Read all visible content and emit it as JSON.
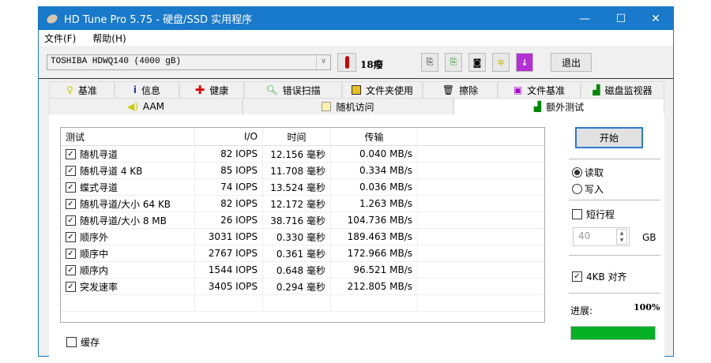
{
  "window": {
    "title": "HD Tune Pro 5.75 - 硬盘/SSD 实用程序",
    "minimize": "—",
    "maximize": "☐",
    "close": "✕"
  },
  "menu": [
    "文件(F)",
    "帮助(H)"
  ],
  "toolbar": {
    "drive": "TOSHIBA HDWQ140 (4000 gB)",
    "temperature": "18癈",
    "exit": "退出"
  },
  "tabs_row1": [
    {
      "label": "基准",
      "icon": "bulb-icon"
    },
    {
      "label": "信息",
      "icon": "info-icon"
    },
    {
      "label": "健康",
      "icon": "health-cross-icon"
    },
    {
      "label": "错误扫描",
      "icon": "magnifier-icon"
    },
    {
      "label": "文件夹使用",
      "icon": "folder-icon"
    },
    {
      "label": "擦除",
      "icon": "trash-icon"
    },
    {
      "label": "文件基准",
      "icon": "file-benchmark-icon"
    },
    {
      "label": "磁盘监视器",
      "icon": "chart-icon"
    }
  ],
  "tabs_row2": [
    {
      "label": "AAM",
      "icon": "speaker-icon"
    },
    {
      "label": "随机访问",
      "icon": "scatter-icon"
    },
    {
      "label": "额外测试",
      "icon": "extra-test-icon"
    }
  ],
  "table": {
    "headers": [
      "测试",
      "I/O",
      "时间",
      "传输"
    ],
    "rows": [
      {
        "test": "随机寻道",
        "io": "82 IOPS",
        "time": "12.156 毫秒",
        "transfer": "0.040 MB/s",
        "checked": true
      },
      {
        "test": "随机寻道 4 KB",
        "io": "85 IOPS",
        "time": "11.708 毫秒",
        "transfer": "0.334 MB/s",
        "checked": true
      },
      {
        "test": "蝶式寻道",
        "io": "74 IOPS",
        "time": "13.524 毫秒",
        "transfer": "0.036 MB/s",
        "checked": true
      },
      {
        "test": "随机寻道/大小 64 KB",
        "io": "82 IOPS",
        "time": "12.172 毫秒",
        "transfer": "1.263 MB/s",
        "checked": true
      },
      {
        "test": "随机寻道/大小 8 MB",
        "io": "26 IOPS",
        "time": "38.716 毫秒",
        "transfer": "104.736 MB/s",
        "checked": true
      },
      {
        "test": "顺序外",
        "io": "3031 IOPS",
        "time": "0.330 毫秒",
        "transfer": "189.463 MB/s",
        "checked": true
      },
      {
        "test": "顺序中",
        "io": "2767 IOPS",
        "time": "0.361 毫秒",
        "transfer": "172.966 MB/s",
        "checked": true
      },
      {
        "test": "顺序内",
        "io": "1544 IOPS",
        "time": "0.648 毫秒",
        "transfer": "96.521 MB/s",
        "checked": true
      },
      {
        "test": "突发速率",
        "io": "3405 IOPS",
        "time": "0.294 毫秒",
        "transfer": "212.805 MB/s",
        "checked": true
      }
    ]
  },
  "cache_label": "缓存",
  "side": {
    "start": "开始",
    "read": "读取",
    "write": "写入",
    "short_stroke": "短行程",
    "stroke_value": "40",
    "stroke_unit": "GB",
    "align_4kb": "4KB 对齐",
    "progress_label": "进展:",
    "progress_text": "100%",
    "progress": 100,
    "progress_color": "#06b025"
  }
}
